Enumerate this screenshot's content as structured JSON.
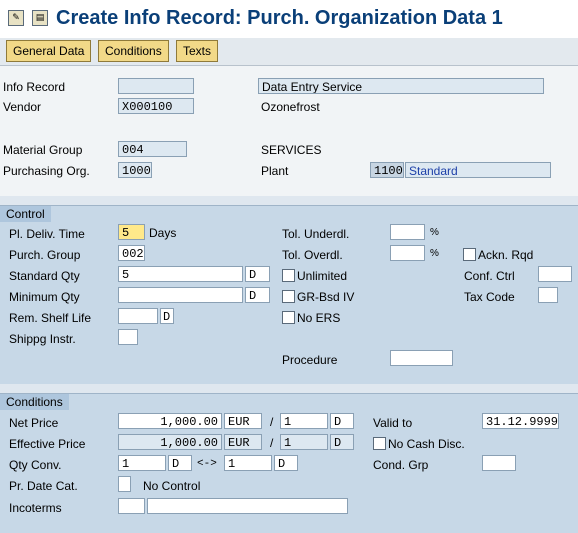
{
  "title": "Create Info Record: Purch. Organization Data 1",
  "tabs": [
    "General Data",
    "Conditions",
    "Texts"
  ],
  "header": {
    "info_record_label": "Info Record",
    "info_record_value": "",
    "info_record_text": "Data Entry Service",
    "vendor_label": "Vendor",
    "vendor_value": "X000100",
    "vendor_name": "Ozonefrost",
    "material_group_label": "Material Group",
    "material_group_value": "004",
    "material_group_text": "SERVICES",
    "purch_org_label": "Purchasing Org.",
    "purch_org_value": "1000",
    "plant_label": "Plant",
    "plant_value": "1100",
    "plant_name": "Standard"
  },
  "control": {
    "title": "Control",
    "pl_deliv_time_label": "Pl. Deliv. Time",
    "pl_deliv_time_value": "5",
    "days_label": "Days",
    "purch_group_label": "Purch. Group",
    "purch_group_value": "002",
    "standard_qty_label": "Standard Qty",
    "standard_qty_value": "5",
    "standard_qty_unit": "D",
    "minimum_qty_label": "Minimum Qty",
    "minimum_qty_value": "",
    "minimum_qty_unit": "D",
    "rem_shelf_life_label": "Rem. Shelf Life",
    "rem_shelf_life_value": "",
    "rem_shelf_life_unit": "D",
    "shippg_instr_label": "Shippg Instr.",
    "shippg_instr_value": "",
    "tol_underdl_label": "Tol. Underdl.",
    "tol_underdl_value": "",
    "tol_overdl_label": "Tol. Overdl.",
    "tol_overdl_value": "",
    "percent": "%",
    "unlimited_label": "Unlimited",
    "gr_bsd_iv_label": "GR-Bsd IV",
    "no_ers_label": "No ERS",
    "procedure_label": "Procedure",
    "procedure_value": "",
    "ackn_rqd_label": "Ackn. Rqd",
    "conf_ctrl_label": "Conf. Ctrl",
    "conf_ctrl_value": "",
    "tax_code_label": "Tax Code",
    "tax_code_value": ""
  },
  "conditions": {
    "title": "Conditions",
    "net_price_label": "Net Price",
    "net_price_value": "1,000.00",
    "net_price_currency": "EUR",
    "net_price_per": "1",
    "net_price_unit": "D",
    "effective_price_label": "Effective Price",
    "effective_price_value": "1,000.00",
    "effective_price_currency": "EUR",
    "effective_price_per": "1",
    "effective_price_unit": "D",
    "slash": "/",
    "qty_conv_label": "Qty Conv.",
    "qty_conv_from": "1",
    "qty_conv_from_unit": "D",
    "arrow": "<->",
    "qty_conv_to": "1",
    "qty_conv_to_unit": "D",
    "pr_date_cat_label": "Pr. Date Cat.",
    "pr_date_cat_value": "",
    "pr_date_cat_text": "No Control",
    "incoterms_label": "Incoterms",
    "incoterms_value": "",
    "incoterms_text": "",
    "valid_to_label": "Valid to",
    "valid_to_value": "31.12.9999",
    "no_cash_disc_label": "No Cash Disc.",
    "cond_grp_label": "Cond. Grp",
    "cond_grp_value": ""
  }
}
